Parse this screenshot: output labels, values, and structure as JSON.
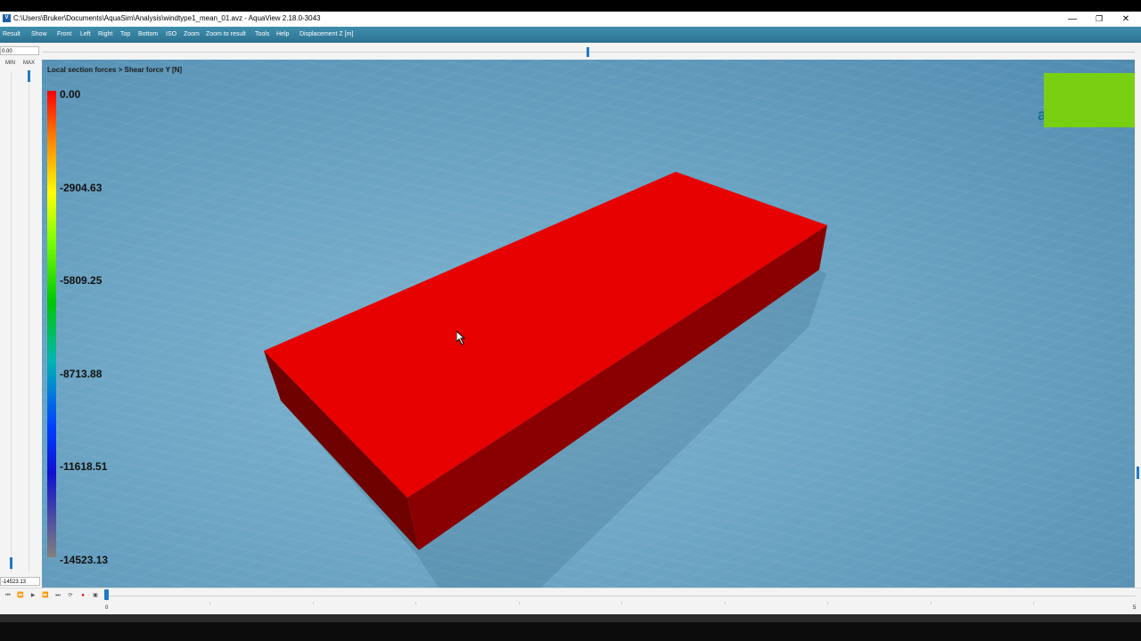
{
  "window": {
    "title": "C:\\Users\\Bruker\\Documents\\AquaSim\\Analysis\\windtype1_mean_01.avz - AquaView 2.18.0-3043",
    "app_icon": "aquaview-app-icon",
    "minimize_glyph": "—",
    "restore_glyph": "❐",
    "close_glyph": "✕"
  },
  "menu": {
    "items": [
      "Result",
      "Show",
      "Front",
      "Left",
      "Right",
      "Top",
      "Bottom",
      "ISO",
      "Zoom",
      "Zoom to result",
      "Tools",
      "Help",
      "Displacement Z [m]"
    ]
  },
  "top_slider": {
    "value": "0.00",
    "position": 0.5
  },
  "left_panel": {
    "min_label": "MIN",
    "max_label": "MAX",
    "bottom_value": "-14523.13"
  },
  "viewport": {
    "section_title": "Local section forces > Shear force Y [N]",
    "legend_labels": [
      "0.00",
      "-2904.63",
      "-5809.25",
      "-8713.88",
      "-11618.51",
      "-14523.13"
    ],
    "model_colors": {
      "top": "#e60000",
      "front": "#6e0000",
      "right": "#8a0000"
    },
    "water_color": "#6ea6c5"
  },
  "playbar": {
    "buttons": [
      "⏮",
      "⏪",
      "▶",
      "⏩",
      "⏭",
      "⟳",
      "●",
      "▣"
    ],
    "start_label": "0",
    "end_label": "5",
    "position": 0
  }
}
